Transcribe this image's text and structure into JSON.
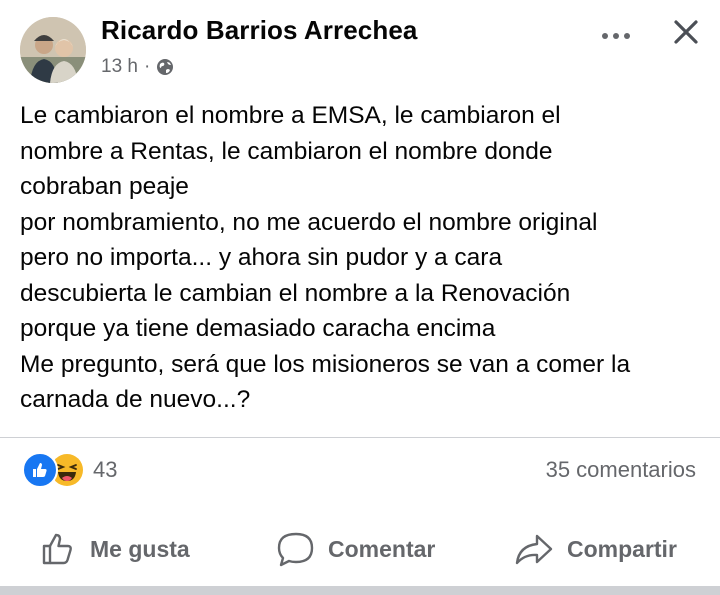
{
  "post": {
    "author": "Ricardo Barrios Arrechea",
    "time": "13 h",
    "separator": "·",
    "text_lines": [
      "Le cambiaron el nombre a EMSA, le cambiaron el",
      "nombre a Rentas, le cambiaron el nombre donde",
      "cobraban peaje",
      "por nombramiento, no me acuerdo el nombre original",
      "pero no importa... y ahora sin pudor y a cara",
      "descubierta le cambian el nombre a la Renovación",
      "porque ya tiene demasiado caracha encima",
      "Me pregunto, será que los misioneros se van a comer la",
      "carnada de nuevo...?"
    ]
  },
  "header_icons": {
    "audience": "globe-icon",
    "more": "more-options-icon",
    "close": "close-icon"
  },
  "stats": {
    "reaction_icons": [
      "like-reaction-icon",
      "haha-reaction-icon"
    ],
    "reaction_count": "43",
    "comments": "35 comentarios"
  },
  "actions": {
    "like": "Me gusta",
    "comment": "Comentar",
    "share": "Compartir"
  },
  "colors": {
    "text": "#050505",
    "secondary": "#65676b",
    "like_blue": "#1877f2",
    "haha_yellow": "#f7b928",
    "divider": "#ced0d4"
  }
}
